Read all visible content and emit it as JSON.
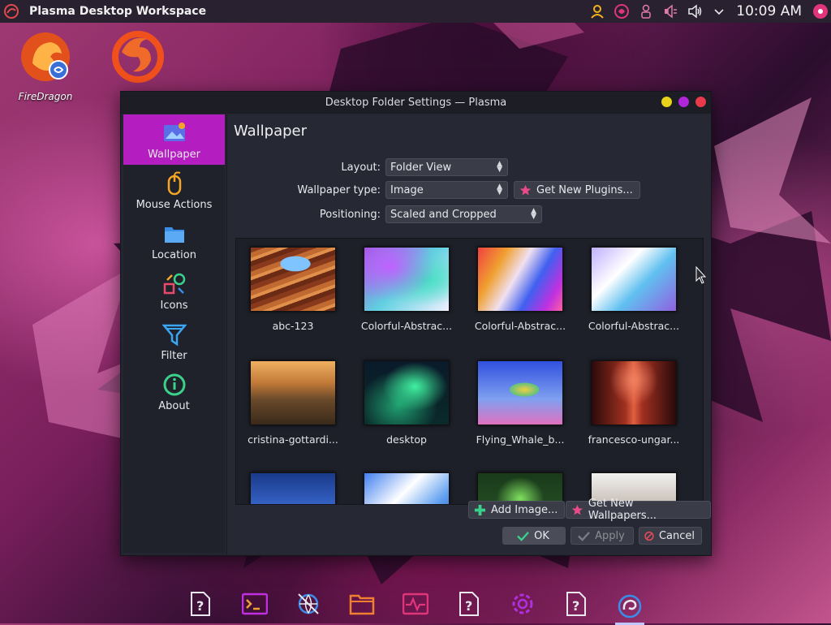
{
  "top_panel": {
    "title": "Plasma Desktop Workspace",
    "clock": "10:09 AM",
    "tray_icons": [
      "user-icon",
      "firedragon-sync-icon",
      "person-icon",
      "audio-input-icon",
      "volume-icon",
      "chevron-down-icon"
    ]
  },
  "desktop_icons": [
    {
      "label": "FireDragon"
    },
    {
      "label": "Firefox"
    }
  ],
  "window": {
    "title": "Desktop Folder Settings — Plasma",
    "sidebar": [
      {
        "label": "Wallpaper"
      },
      {
        "label": "Mouse Actions"
      },
      {
        "label": "Location"
      },
      {
        "label": "Icons"
      },
      {
        "label": "Filter"
      },
      {
        "label": "About"
      }
    ],
    "page_title": "Wallpaper",
    "layout_label": "Layout:",
    "layout_value": "Folder View",
    "type_label": "Wallpaper type:",
    "type_value": "Image",
    "plugins_button": "Get New Plugins...",
    "positioning_label": "Positioning:",
    "positioning_value": "Scaled and Cropped",
    "wallpapers": [
      {
        "label": "abc-123"
      },
      {
        "label": "Colorful-Abstrac..."
      },
      {
        "label": "Colorful-Abstrac..."
      },
      {
        "label": "Colorful-Abstrac..."
      },
      {
        "label": "cristina-gottardi..."
      },
      {
        "label": "desktop"
      },
      {
        "label": "Flying_Whale_b..."
      },
      {
        "label": "francesco-ungar..."
      },
      {
        "label": ""
      },
      {
        "label": ""
      },
      {
        "label": ""
      },
      {
        "label": ""
      }
    ],
    "add_image_button": "Add Image...",
    "get_wallpapers_button": "Get New Wallpapers...",
    "ok_button": "OK",
    "apply_button": "Apply",
    "cancel_button": "Cancel"
  },
  "taskbar": {
    "items": [
      "unknown-app-icon",
      "terminal-icon",
      "network-icon",
      "files-icon",
      "system-monitor-icon",
      "unknown-app-icon",
      "settings-icon",
      "unknown-app-icon",
      "plasma-settings-icon"
    ]
  }
}
